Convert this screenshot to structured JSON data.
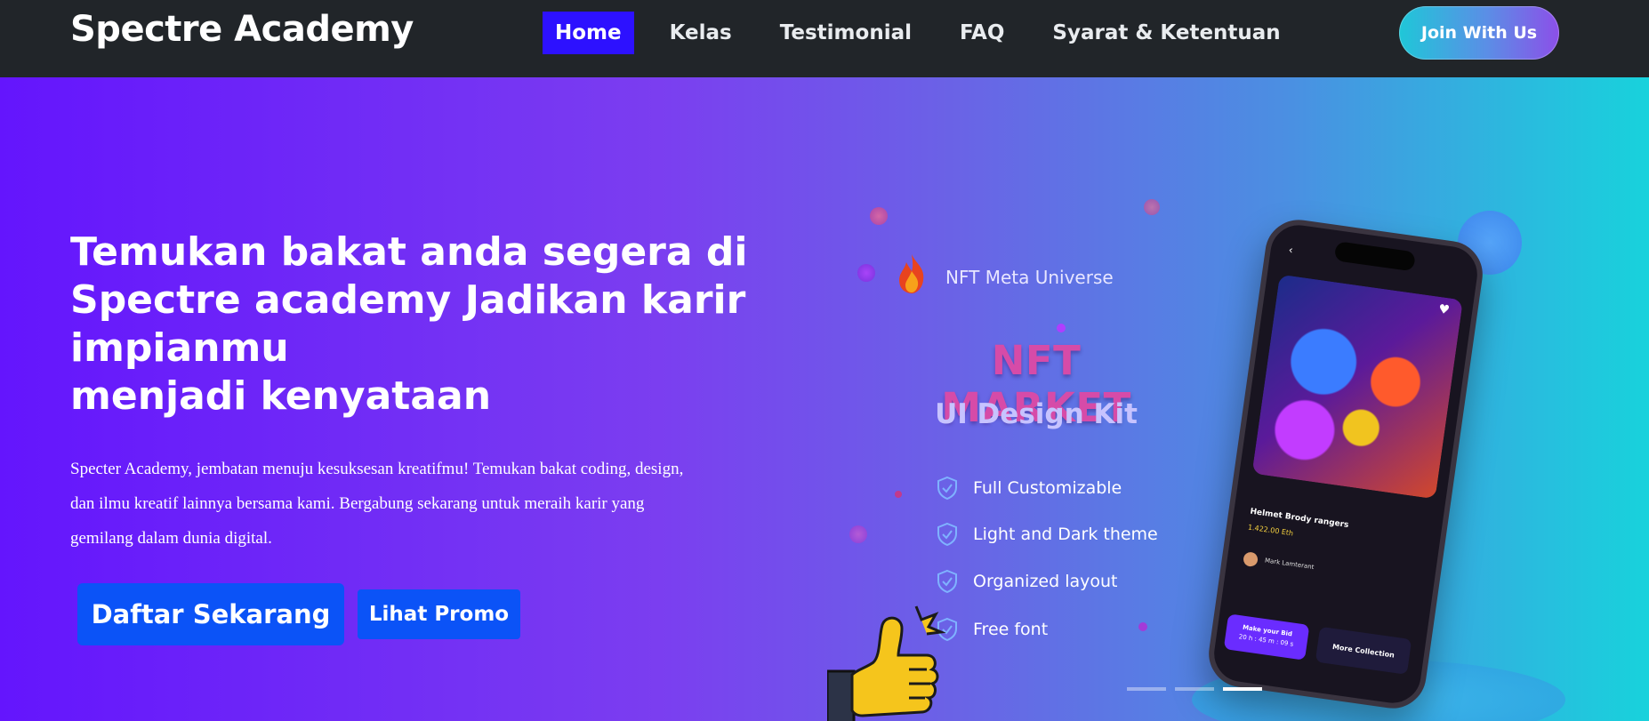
{
  "navbar": {
    "brand": "Spectre Academy",
    "links": [
      {
        "label": "Home",
        "active": true
      },
      {
        "label": "Kelas",
        "active": false
      },
      {
        "label": "Testimonial",
        "active": false
      },
      {
        "label": "FAQ",
        "active": false
      },
      {
        "label": "Syarat & Ketentuan",
        "active": false
      }
    ],
    "cta": "Join With Us"
  },
  "hero": {
    "headline_lines": [
      "Temukan bakat anda segera di",
      "Spectre academy Jadikan karir",
      "impianmu",
      "menjadi kenyataan"
    ],
    "description_lines": [
      "Specter Academy, jembatan menuju kesuksesan kreatifmu! Temukan bakat coding, design,",
      "dan ilmu kreatif lainnya bersama kami. Bergabung sekarang untuk meraih karir yang",
      "gemilang dalam dunia digital."
    ],
    "primary_button": "Daftar Sekarang",
    "secondary_button": "Lihat Promo"
  },
  "slide": {
    "brand": "NFT Meta Universe",
    "title": "NFT MARKET",
    "subtitle": "UI Design Kit",
    "features": [
      "Full Customizable",
      "Light and Dark theme",
      "Organized layout",
      "Free font"
    ],
    "phone": {
      "item_name": "Helmet Brody rangers",
      "price": "1.422.00 Eth",
      "owner": "Mark Lamterant",
      "bid_label": "Make your Bid",
      "bid_timer": "20 h : 45 m : 09 s",
      "collection_label": "More Collection"
    },
    "indicator_count": 3,
    "active_indicator": 2
  },
  "colors": {
    "navbar_bg": "#212529",
    "active_link": "#2d11ff",
    "button_blue": "#0b53f7",
    "hero_gradient_start": "#6415fd",
    "hero_gradient_end": "#18d2dc"
  },
  "icons": [
    "flame-icon",
    "shield-check-icon",
    "thumbs-up-icon",
    "heart-icon",
    "back-arrow-icon"
  ]
}
